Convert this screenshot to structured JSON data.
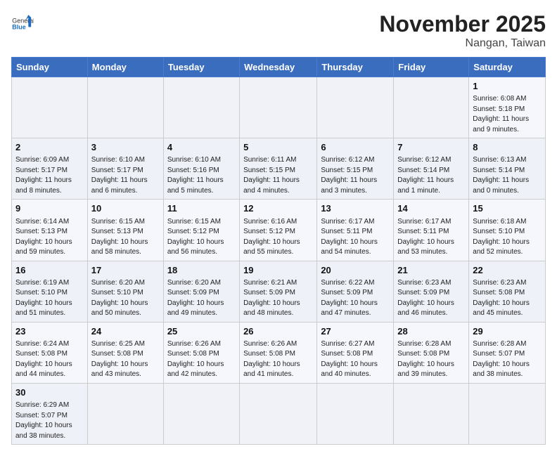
{
  "header": {
    "logo_general": "General",
    "logo_blue": "Blue",
    "title": "November 2025",
    "subtitle": "Nangan, Taiwan"
  },
  "weekdays": [
    "Sunday",
    "Monday",
    "Tuesday",
    "Wednesday",
    "Thursday",
    "Friday",
    "Saturday"
  ],
  "weeks": [
    [
      {
        "day": "",
        "info": ""
      },
      {
        "day": "",
        "info": ""
      },
      {
        "day": "",
        "info": ""
      },
      {
        "day": "",
        "info": ""
      },
      {
        "day": "",
        "info": ""
      },
      {
        "day": "",
        "info": ""
      },
      {
        "day": "1",
        "info": "Sunrise: 6:08 AM\nSunset: 5:18 PM\nDaylight: 11 hours\nand 9 minutes."
      }
    ],
    [
      {
        "day": "2",
        "info": "Sunrise: 6:09 AM\nSunset: 5:17 PM\nDaylight: 11 hours\nand 8 minutes."
      },
      {
        "day": "3",
        "info": "Sunrise: 6:10 AM\nSunset: 5:17 PM\nDaylight: 11 hours\nand 6 minutes."
      },
      {
        "day": "4",
        "info": "Sunrise: 6:10 AM\nSunset: 5:16 PM\nDaylight: 11 hours\nand 5 minutes."
      },
      {
        "day": "5",
        "info": "Sunrise: 6:11 AM\nSunset: 5:15 PM\nDaylight: 11 hours\nand 4 minutes."
      },
      {
        "day": "6",
        "info": "Sunrise: 6:12 AM\nSunset: 5:15 PM\nDaylight: 11 hours\nand 3 minutes."
      },
      {
        "day": "7",
        "info": "Sunrise: 6:12 AM\nSunset: 5:14 PM\nDaylight: 11 hours\nand 1 minute."
      },
      {
        "day": "8",
        "info": "Sunrise: 6:13 AM\nSunset: 5:14 PM\nDaylight: 11 hours\nand 0 minutes."
      }
    ],
    [
      {
        "day": "9",
        "info": "Sunrise: 6:14 AM\nSunset: 5:13 PM\nDaylight: 10 hours\nand 59 minutes."
      },
      {
        "day": "10",
        "info": "Sunrise: 6:15 AM\nSunset: 5:13 PM\nDaylight: 10 hours\nand 58 minutes."
      },
      {
        "day": "11",
        "info": "Sunrise: 6:15 AM\nSunset: 5:12 PM\nDaylight: 10 hours\nand 56 minutes."
      },
      {
        "day": "12",
        "info": "Sunrise: 6:16 AM\nSunset: 5:12 PM\nDaylight: 10 hours\nand 55 minutes."
      },
      {
        "day": "13",
        "info": "Sunrise: 6:17 AM\nSunset: 5:11 PM\nDaylight: 10 hours\nand 54 minutes."
      },
      {
        "day": "14",
        "info": "Sunrise: 6:17 AM\nSunset: 5:11 PM\nDaylight: 10 hours\nand 53 minutes."
      },
      {
        "day": "15",
        "info": "Sunrise: 6:18 AM\nSunset: 5:10 PM\nDaylight: 10 hours\nand 52 minutes."
      }
    ],
    [
      {
        "day": "16",
        "info": "Sunrise: 6:19 AM\nSunset: 5:10 PM\nDaylight: 10 hours\nand 51 minutes."
      },
      {
        "day": "17",
        "info": "Sunrise: 6:20 AM\nSunset: 5:10 PM\nDaylight: 10 hours\nand 50 minutes."
      },
      {
        "day": "18",
        "info": "Sunrise: 6:20 AM\nSunset: 5:09 PM\nDaylight: 10 hours\nand 49 minutes."
      },
      {
        "day": "19",
        "info": "Sunrise: 6:21 AM\nSunset: 5:09 PM\nDaylight: 10 hours\nand 48 minutes."
      },
      {
        "day": "20",
        "info": "Sunrise: 6:22 AM\nSunset: 5:09 PM\nDaylight: 10 hours\nand 47 minutes."
      },
      {
        "day": "21",
        "info": "Sunrise: 6:23 AM\nSunset: 5:09 PM\nDaylight: 10 hours\nand 46 minutes."
      },
      {
        "day": "22",
        "info": "Sunrise: 6:23 AM\nSunset: 5:08 PM\nDaylight: 10 hours\nand 45 minutes."
      }
    ],
    [
      {
        "day": "23",
        "info": "Sunrise: 6:24 AM\nSunset: 5:08 PM\nDaylight: 10 hours\nand 44 minutes."
      },
      {
        "day": "24",
        "info": "Sunrise: 6:25 AM\nSunset: 5:08 PM\nDaylight: 10 hours\nand 43 minutes."
      },
      {
        "day": "25",
        "info": "Sunrise: 6:26 AM\nSunset: 5:08 PM\nDaylight: 10 hours\nand 42 minutes."
      },
      {
        "day": "26",
        "info": "Sunrise: 6:26 AM\nSunset: 5:08 PM\nDaylight: 10 hours\nand 41 minutes."
      },
      {
        "day": "27",
        "info": "Sunrise: 6:27 AM\nSunset: 5:08 PM\nDaylight: 10 hours\nand 40 minutes."
      },
      {
        "day": "28",
        "info": "Sunrise: 6:28 AM\nSunset: 5:08 PM\nDaylight: 10 hours\nand 39 minutes."
      },
      {
        "day": "29",
        "info": "Sunrise: 6:28 AM\nSunset: 5:07 PM\nDaylight: 10 hours\nand 38 minutes."
      }
    ],
    [
      {
        "day": "30",
        "info": "Sunrise: 6:29 AM\nSunset: 5:07 PM\nDaylight: 10 hours\nand 38 minutes."
      },
      {
        "day": "",
        "info": ""
      },
      {
        "day": "",
        "info": ""
      },
      {
        "day": "",
        "info": ""
      },
      {
        "day": "",
        "info": ""
      },
      {
        "day": "",
        "info": ""
      },
      {
        "day": "",
        "info": ""
      }
    ]
  ]
}
